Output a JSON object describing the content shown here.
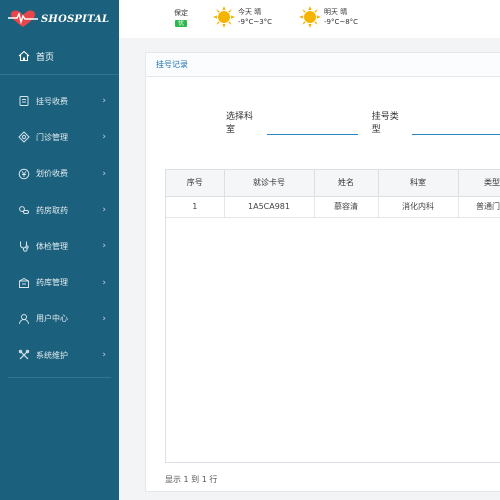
{
  "brand": {
    "name": "SHOSPITAL",
    "accent": "#e8464b",
    "sidebar_bg": "#1b607c"
  },
  "header": {
    "aqi": {
      "label": "保定",
      "badge": "优",
      "badge_color": "#2db84d"
    },
    "weather_today": {
      "icon": "sun-icon",
      "line1": "今天  晴",
      "line2": "-9°C~3°C"
    },
    "weather_tomorrow": {
      "icon": "sun-icon",
      "line1": "明天  晴",
      "line2": "-9°C~8°C"
    }
  },
  "sidebar": {
    "home": {
      "label": "首页",
      "icon": "home-icon"
    },
    "items": [
      {
        "label": "挂号收费",
        "icon": "register-icon"
      },
      {
        "label": "门诊管理",
        "icon": "outpatient-icon"
      },
      {
        "label": "划价收费",
        "icon": "pricing-icon"
      },
      {
        "label": "药房取药",
        "icon": "pharmacy-icon"
      },
      {
        "label": "体检管理",
        "icon": "checkup-icon"
      },
      {
        "label": "药库管理",
        "icon": "warehouse-icon"
      },
      {
        "label": "用户中心",
        "icon": "user-icon"
      },
      {
        "label": "系统维护",
        "icon": "tools-icon"
      }
    ]
  },
  "panel": {
    "title": "挂号记录",
    "filters": {
      "department_label": "选择科室",
      "department_value": "",
      "type_label": "挂号类型",
      "type_value": ""
    },
    "table": {
      "columns": [
        "序号",
        "就诊卡号",
        "姓名",
        "科室",
        "类型"
      ],
      "rows": [
        [
          "1",
          "1A5CA981",
          "慕容清",
          "消化内科",
          "普通门诊"
        ]
      ]
    },
    "footer": "显示 1 到 1 行"
  }
}
